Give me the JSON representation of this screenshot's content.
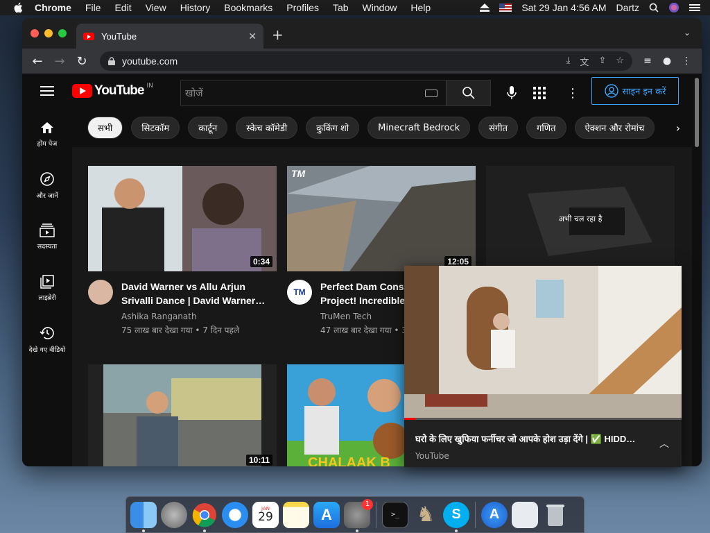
{
  "menubar": {
    "app": "Chrome",
    "items": [
      "File",
      "Edit",
      "View",
      "History",
      "Bookmarks",
      "Profiles",
      "Tab",
      "Window",
      "Help"
    ],
    "datetime": "Sat 29 Jan  4:56 AM",
    "user": "Dartz"
  },
  "browser": {
    "tab_title": "YouTube",
    "url": "youtube.com"
  },
  "youtube": {
    "logo": "YouTube",
    "country": "IN",
    "search_placeholder": "खोजें",
    "signin": "साइन इन करें",
    "sidebar": [
      {
        "label": "होम पेज",
        "icon": "home-icon"
      },
      {
        "label": "और जानें",
        "icon": "explore-icon"
      },
      {
        "label": "सदस्यता",
        "icon": "subscriptions-icon"
      },
      {
        "label": "लाइब्रेरी",
        "icon": "library-icon"
      },
      {
        "label": "देखे गए वीडियो",
        "icon": "history-icon"
      }
    ],
    "chips": [
      "सभी",
      "सिटकॉम",
      "कार्टून",
      "स्केच कॉमेडी",
      "कुकिंग शो",
      "Minecraft Bedrock",
      "संगीत",
      "गणित",
      "ऐक्शन और रोमांच"
    ],
    "videos": [
      {
        "title": "David Warner vs Allu Arjun Srivalli Dance | David Warner…",
        "channel": "Ashika Ranganath",
        "stats": "75 लाख बार देखा गया • 7 दिन पहले",
        "duration": "0:34"
      },
      {
        "title": "Perfect Dam Construction Project! Incredible M…",
        "channel": "TruMen Tech",
        "stats": "47 लाख बार देखा गया • 3 म…",
        "duration": "12:05"
      },
      {
        "now_playing": "अभी चल रहा है"
      },
      {
        "duration": "10:11"
      },
      {
        "duration": ""
      }
    ],
    "miniplayer": {
      "title": "घरो के लिए खुफिया फर्नीचर जो आपके होश उड़ा देंगे | ✅ HIDD…",
      "channel": "YouTube"
    }
  },
  "dock": {
    "badge_count": "1",
    "calendar_month": "JAN",
    "calendar_day": "29"
  },
  "colors": {
    "yt_red": "#ff0000",
    "signin_blue": "#3ea6ff",
    "page_bg": "#0f0f0f"
  }
}
